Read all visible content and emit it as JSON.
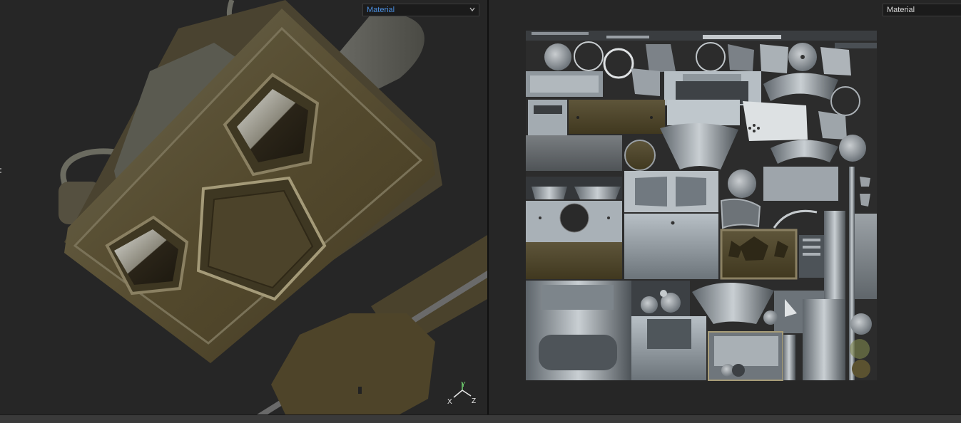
{
  "viewport_3d": {
    "material_dropdown": {
      "value": "Material"
    },
    "gizmo": {
      "x": "X",
      "y": "Y",
      "z": "Z",
      "x_color": "#e8e8e8",
      "y_color": "#6fd16f",
      "z_color": "#e8e8e8"
    }
  },
  "viewport_uv": {
    "material_dropdown": {
      "value": "Material"
    }
  },
  "colors": {
    "background": "#262626",
    "active_dropdown_text": "#4b8fe0",
    "model_olive": "#4f452c",
    "texture_steel": "#a7b0b8"
  }
}
